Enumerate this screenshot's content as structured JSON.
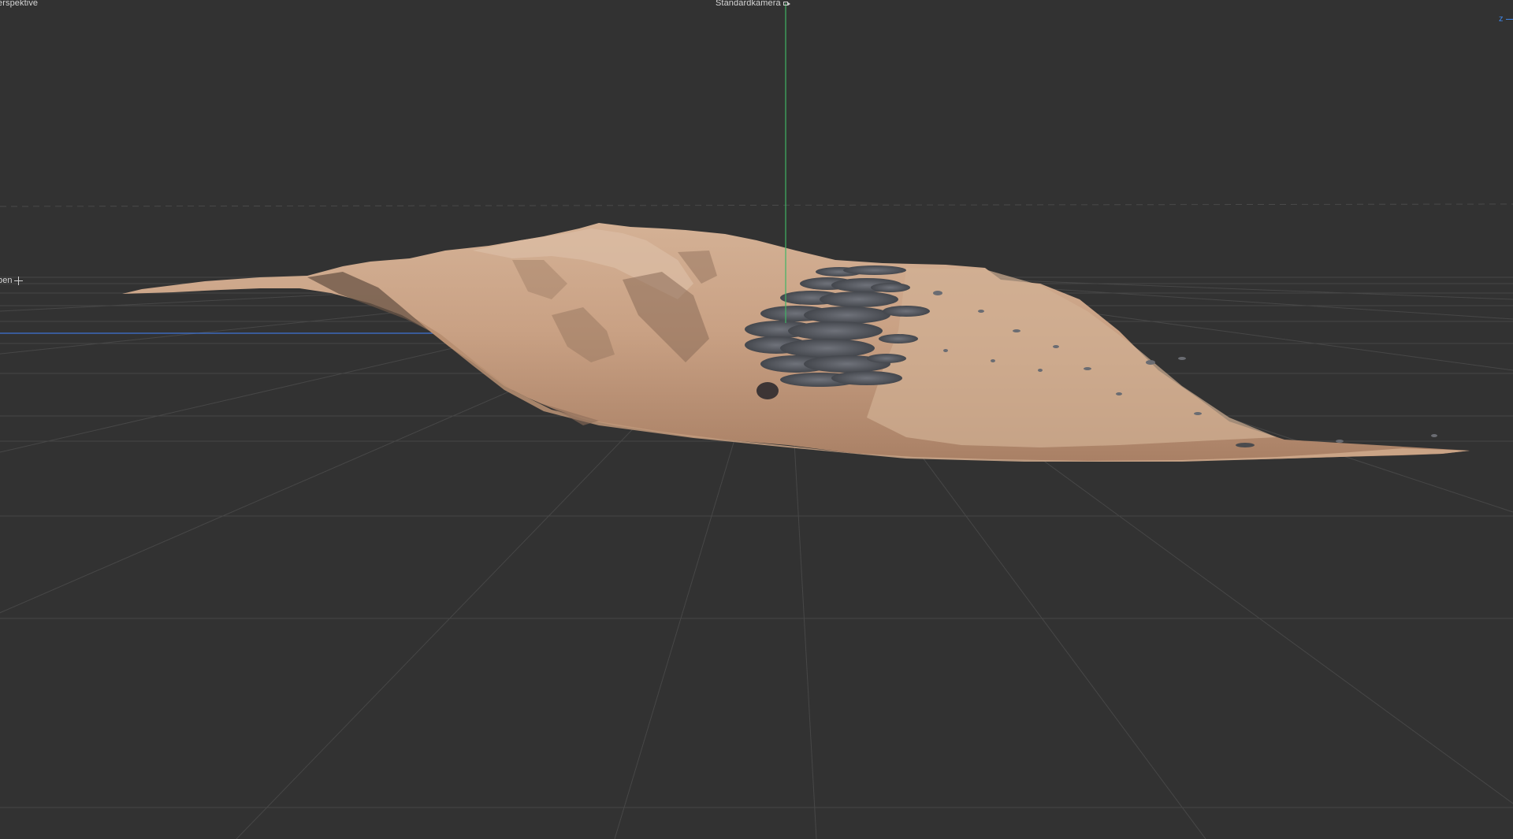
{
  "viewport": {
    "view_name": "erspektive",
    "camera_label": "Standardkamera",
    "camera_icon": "camera-icon",
    "axis_indicator": "z",
    "side_view_label": "ben",
    "side_view_icon": "move-cross-icon"
  },
  "colors": {
    "background": "#323232",
    "grid": "#474747",
    "axis_x": "#3f74d6",
    "axis_y": "#3fb565",
    "terrain_sand": "#c49a7c",
    "rocks": "#5c5f66"
  },
  "scene": {
    "object": "sand-dune-terrain-scan"
  }
}
